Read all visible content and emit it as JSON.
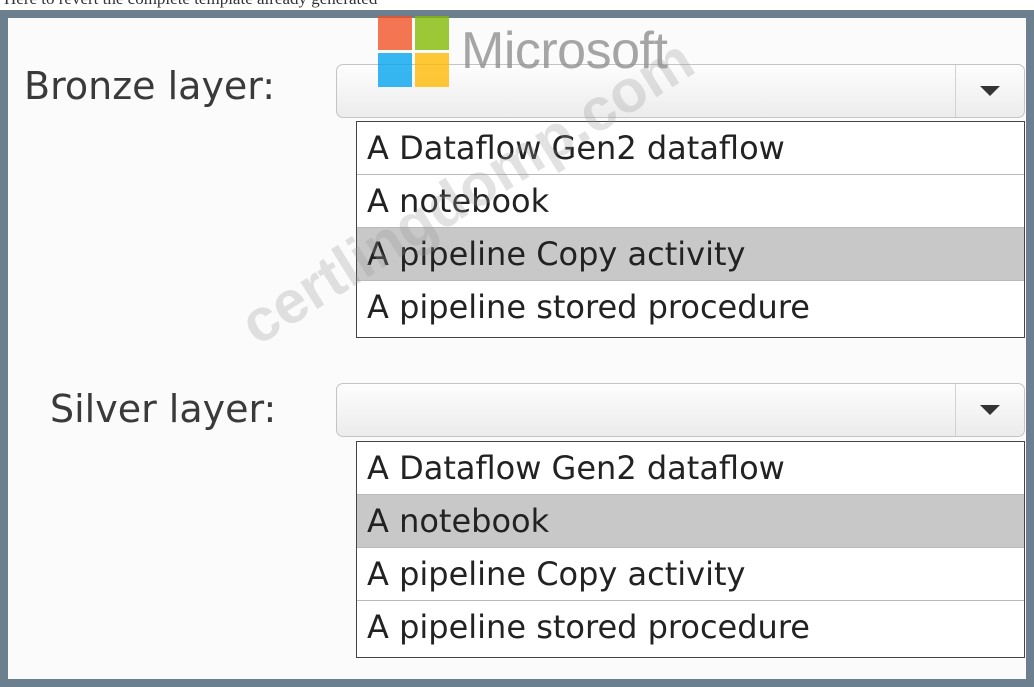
{
  "header": {
    "clipped_text": "Here to revert the complete template already generated"
  },
  "logo": {
    "text": "Microsoft",
    "colors": [
      "#f25022",
      "#7fba00",
      "#00a4ef",
      "#ffb900"
    ]
  },
  "watermark": {
    "text": "certlingdomp.com"
  },
  "bronze": {
    "label": "Bronze layer:",
    "options": [
      "A Dataflow Gen2 dataflow",
      "A notebook",
      "A pipeline Copy activity",
      "A pipeline stored procedure"
    ],
    "selected_option": "A pipeline Copy activity"
  },
  "silver": {
    "label": "Silver layer:",
    "options": [
      "A Dataflow Gen2 dataflow",
      "A notebook",
      "A pipeline Copy activity",
      "A pipeline stored procedure"
    ],
    "selected_option": "A notebook"
  },
  "colors": {
    "frame": "#6b7f8e",
    "selected_row": "#c8c8c8"
  }
}
